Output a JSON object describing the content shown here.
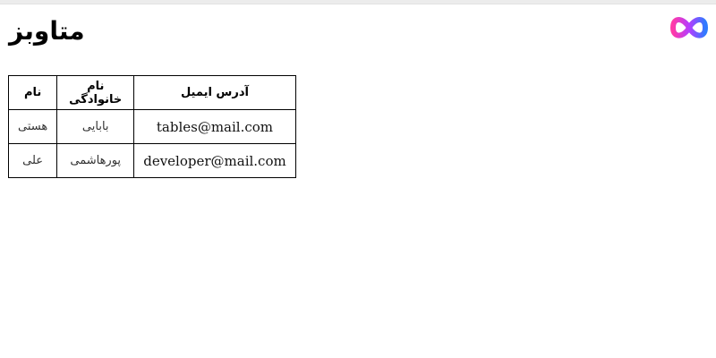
{
  "page": {
    "title": "متاوبز"
  },
  "logo": {
    "icon": "infinity-logo-icon",
    "colors": [
      "#2f7bff",
      "#b43cff",
      "#ff3aa8"
    ]
  },
  "table": {
    "headers": {
      "first_name": "نام",
      "last_name": "نام خانوادگی",
      "email": "آدرس ایمیل"
    },
    "rows": [
      {
        "first_name": "هستی",
        "last_name": "بابایی",
        "email": "tables@mail.com"
      },
      {
        "first_name": "علی",
        "last_name": "پورهاشمی",
        "email": "developer@mail.com"
      }
    ]
  }
}
